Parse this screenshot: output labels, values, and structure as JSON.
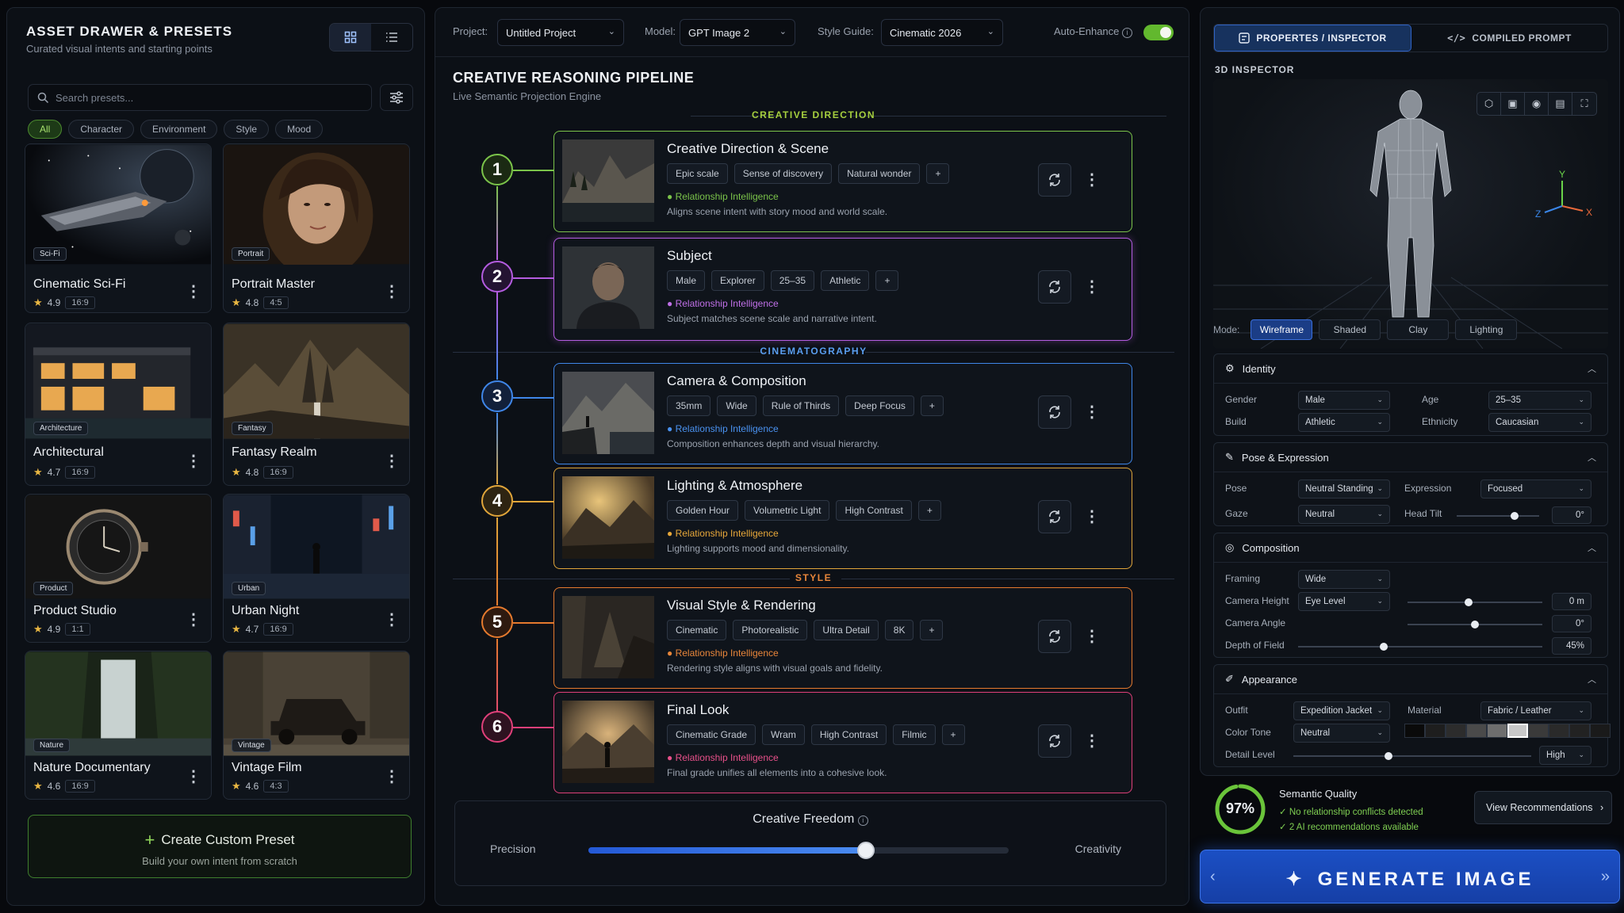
{
  "left": {
    "title": "ASSET DRAWER & PRESETS",
    "subtitle": "Curated visual intents and starting points",
    "search_placeholder": "Search presets...",
    "filters": [
      "All",
      "Character",
      "Environment",
      "Style",
      "Mood"
    ],
    "presets": [
      {
        "name": "Cinematic Sci-Fi",
        "tag": "Sci-Fi",
        "rating": "4.9",
        "ratio": "16:9"
      },
      {
        "name": "Portrait Master",
        "tag": "Portrait",
        "rating": "4.8",
        "ratio": "4:5"
      },
      {
        "name": "Architectural",
        "tag": "Architecture",
        "rating": "4.7",
        "ratio": "16:9"
      },
      {
        "name": "Fantasy Realm",
        "tag": "Fantasy",
        "rating": "4.8",
        "ratio": "16:9"
      },
      {
        "name": "Product Studio",
        "tag": "Product",
        "rating": "4.9",
        "ratio": "1:1"
      },
      {
        "name": "Urban Night",
        "tag": "Urban",
        "rating": "4.7",
        "ratio": "16:9"
      },
      {
        "name": "Nature Documentary",
        "tag": "Nature",
        "rating": "4.6",
        "ratio": "16:9"
      },
      {
        "name": "Vintage Film",
        "tag": "Vintage",
        "rating": "4.6",
        "ratio": "4:3"
      }
    ],
    "custom_title": "Create Custom Preset",
    "custom_sub": "Build your own intent from scratch"
  },
  "center": {
    "project_label": "Project:",
    "project_value": "Untitled Project",
    "model_label": "Model:",
    "model_value": "GPT Image 2",
    "style_label": "Style Guide:",
    "style_value": "Cinematic 2026",
    "enhance_label": "Auto-Enhance",
    "enhance_on": true,
    "title": "CREATIVE REASONING PIPELINE",
    "subtitle": "Live Semantic Projection Engine",
    "sections": [
      "CREATIVE DIRECTION",
      "CINEMATOGRAPHY",
      "STYLE"
    ],
    "ri_label": "Relationship Intelligence",
    "steps": [
      {
        "num": "1",
        "title": "Creative Direction & Scene",
        "tags": [
          "Epic scale",
          "Sense of discovery",
          "Natural wonder"
        ],
        "desc": "Aligns scene intent with story mood and world scale.",
        "color": "#7bc44a"
      },
      {
        "num": "2",
        "title": "Subject",
        "tags": [
          "Male",
          "Explorer",
          "25–35",
          "Athletic"
        ],
        "desc": "Subject matches scene scale and narrative intent.",
        "color": "#b45ce0"
      },
      {
        "num": "3",
        "title": "Camera & Composition",
        "tags": [
          "35mm",
          "Wide",
          "Rule of Thirds",
          "Deep Focus"
        ],
        "desc": "Composition enhances depth and visual hierarchy.",
        "color": "#3f86e8"
      },
      {
        "num": "4",
        "title": "Lighting & Atmosphere",
        "tags": [
          "Golden Hour",
          "Volumetric Light",
          "High Contrast"
        ],
        "desc": "Lighting supports mood and dimensionality.",
        "color": "#e0a53a"
      },
      {
        "num": "5",
        "title": "Visual Style & Rendering",
        "tags": [
          "Cinematic",
          "Photorealistic",
          "Ultra Detail",
          "8K"
        ],
        "desc": "Rendering style aligns with visual goals and fidelity.",
        "color": "#e57a2e"
      },
      {
        "num": "6",
        "title": "Final Look",
        "tags": [
          "Cinematic Grade",
          "Wram",
          "High Contrast",
          "Filmic"
        ],
        "desc": "Final grade unifies all elements into a cohesive look.",
        "color": "#e0407a"
      }
    ],
    "freedom_title": "Creative Freedom",
    "freedom_left": "Precision",
    "freedom_right": "Creativity",
    "freedom_value": 0.66
  },
  "right": {
    "tab_inspector": "PROPERTES / INSPECTOR",
    "tab_prompt": "COMPILED PROMPT",
    "viewer_title": "3D INSPECTOR",
    "axis_y": "Y",
    "axis_x": "X",
    "axis_z": "Z",
    "mode_label": "Mode:",
    "modes": [
      "Wireframe",
      "Shaded",
      "Clay",
      "Lighting"
    ],
    "identity": {
      "title": "Identity",
      "gender_label": "Gender",
      "gender": "Male",
      "age_label": "Age",
      "age": "25–35",
      "build_label": "Build",
      "build": "Athletic",
      "ethnicity_label": "Ethnicity",
      "ethnicity": "Caucasian"
    },
    "pose": {
      "title": "Pose & Expression",
      "pose_label": "Pose",
      "pose": "Neutral Standing",
      "expression_label": "Expression",
      "expression": "Focused",
      "gaze_label": "Gaze",
      "gaze": "Neutral",
      "tilt_label": "Head Tilt",
      "tilt": "0°",
      "tilt_level": 0.7
    },
    "composition": {
      "title": "Composition",
      "framing_label": "Framing",
      "framing": "Wide",
      "height_label": "Camera Height",
      "height": "Eye Level",
      "height_val": "0 m",
      "height_level": 0.45,
      "angle_label": "Camera Angle",
      "angle_val": "0°",
      "angle_level": 0.5,
      "dof_label": "Depth of Field",
      "dof_val": "45%",
      "dof_level": 0.35
    },
    "appearance": {
      "title": "Appearance",
      "outfit_label": "Outfit",
      "outfit": "Expedition Jacket",
      "material_label": "Material",
      "material": "Fabric / Leather",
      "tone_label": "Color Tone",
      "tone": "Neutral",
      "detail_label": "Detail Level",
      "detail": "High",
      "detail_level": 0.4
    },
    "quality": {
      "pct": "97%",
      "title": "Semantic Quality",
      "line1": "No relationship conflicts detected",
      "line2": "2 AI recommendations available",
      "button": "View Recommendations"
    },
    "generate": "GENERATE IMAGE"
  }
}
